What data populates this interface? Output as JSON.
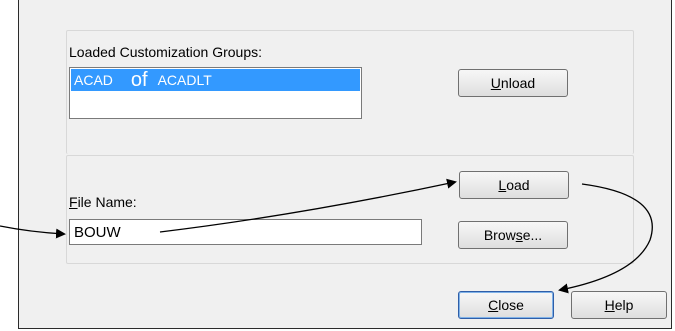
{
  "groups": {
    "loaded_label": "Loaded Customization Groups:",
    "items": [
      "ACAD",
      "of",
      "ACADLT"
    ]
  },
  "buttons": {
    "unload_u": "U",
    "unload_rest": "nload",
    "load_u": "L",
    "load_rest": "oad",
    "browse_pre": "Brow",
    "browse_u": "s",
    "browse_rest": "e...",
    "close_u": "C",
    "close_rest": "lose",
    "help_u": "H",
    "help_rest": "elp"
  },
  "file": {
    "label_u": "F",
    "label_rest": "ile Name:",
    "value": "BOUW"
  },
  "icons": {
    "arrows": "annotation-arrows"
  }
}
